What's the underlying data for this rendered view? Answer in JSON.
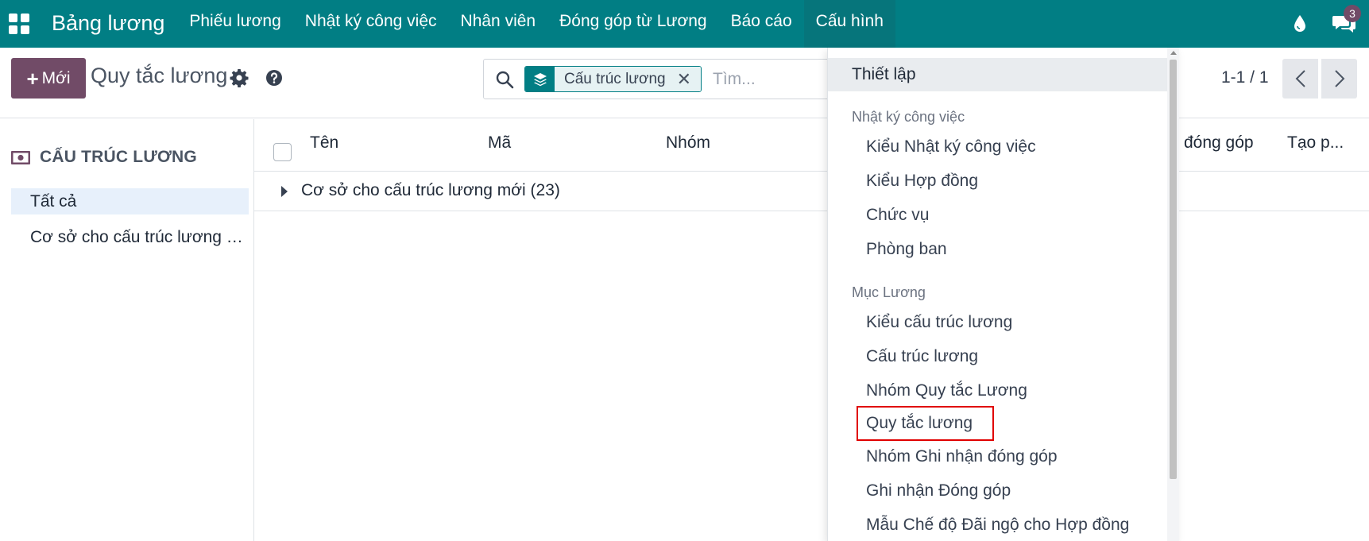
{
  "navbar": {
    "brand": "Bảng lương",
    "menu": [
      "Phiếu lương",
      "Nhật ký công việc",
      "Nhân viên",
      "Đóng góp từ Lương",
      "Báo cáo",
      "Cấu hình"
    ],
    "chat_count": "3",
    "accent": "#017e84"
  },
  "control": {
    "new_button": "Mới",
    "title": "Quy tắc lương",
    "facet_label": "Cấu trúc lương",
    "search_placeholder": "Tìm...",
    "pager": "1-1 / 1"
  },
  "side": {
    "title": "CẤU TRÚC LƯƠNG",
    "items": [
      "Tất cả",
      "Cơ sở cho cấu trúc lương mới"
    ]
  },
  "list": {
    "columns": [
      "Tên",
      "Mã",
      "Nhóm",
      "đóng góp",
      "Tạo p..."
    ],
    "group_label": "Cơ sở cho cấu trúc lương mới (23)"
  },
  "dropdown": {
    "top_item": "Thiết lập",
    "section1": "Nhật ký công việc",
    "section1_items": [
      "Kiểu Nhật ký công việc",
      "Kiểu Hợp đồng",
      "Chức vụ",
      "Phòng ban"
    ],
    "section2": "Mục Lương",
    "section2_items": [
      "Kiểu cấu trúc lương",
      "Cấu trúc lương",
      "Nhóm Quy tắc Lương",
      "Quy tắc lương",
      "Nhóm Ghi nhận đóng góp",
      "Ghi nhận Đóng góp",
      "Mẫu Chế độ Đãi ngộ cho Hợp đồng"
    ]
  }
}
